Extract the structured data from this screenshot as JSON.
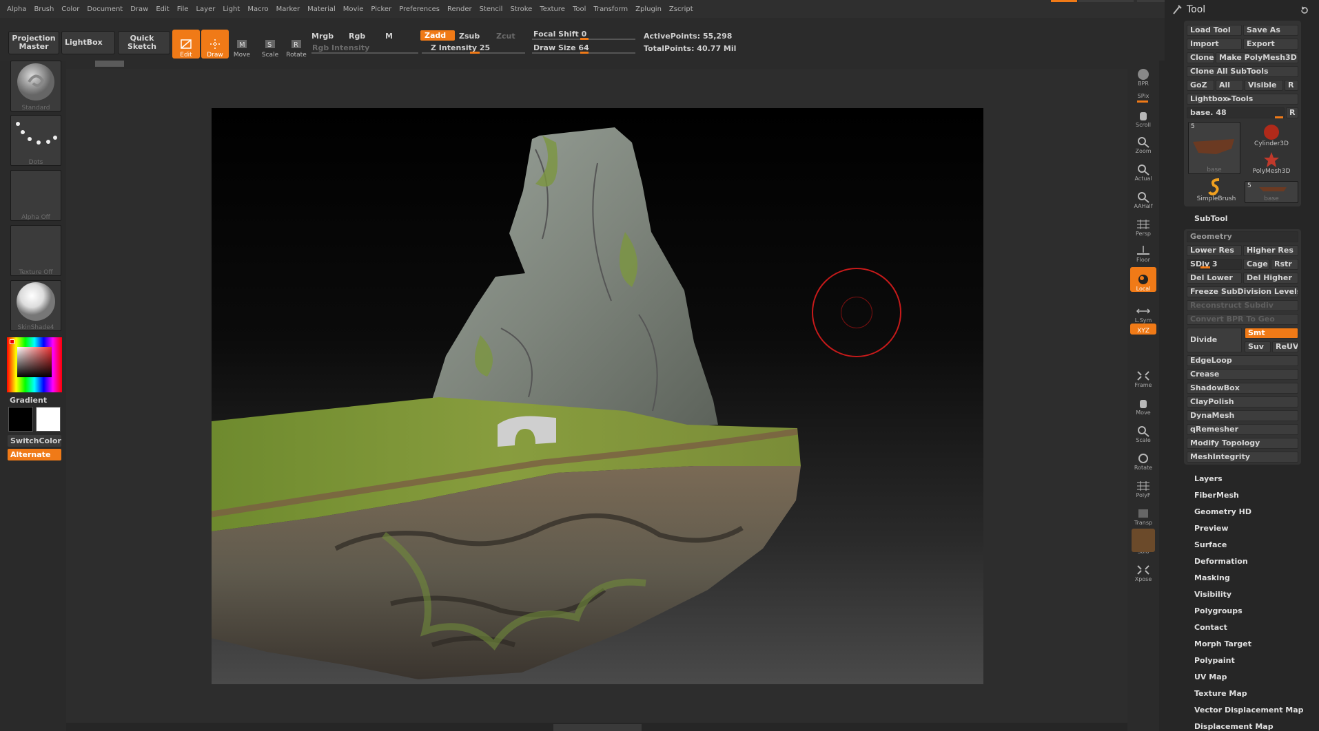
{
  "menu": [
    "Alpha",
    "Brush",
    "Color",
    "Document",
    "Draw",
    "Edit",
    "File",
    "Layer",
    "Light",
    "Macro",
    "Marker",
    "Material",
    "Movie",
    "Picker",
    "Preferences",
    "Render",
    "Stencil",
    "Stroke",
    "Texture",
    "Tool",
    "Transform",
    "Zplugin",
    "Zscript"
  ],
  "toolbar": {
    "projection_master": "Projection Master",
    "lightbox": "LightBox",
    "quick_sketch": "Quick Sketch",
    "edit": "Edit",
    "draw": "Draw",
    "move": "Move",
    "scale": "Scale",
    "rotate": "Rotate",
    "mrgb": "Mrgb",
    "rgb": "Rgb",
    "m": "M",
    "rgb_intensity": "Rgb Intensity",
    "zadd": "Zadd",
    "zsub": "Zsub",
    "zcut": "Zcut",
    "z_intensity": "Z Intensity 25",
    "focal_shift": "Focal Shift 0",
    "draw_size": "Draw Size 64",
    "active_points": "ActivePoints: 55,298",
    "total_points": "TotalPoints: 40.77 Mil"
  },
  "left_tray": {
    "brush": "Standard",
    "stroke": "Dots",
    "alpha": "Alpha Off",
    "texture": "Texture Off",
    "material": "SkinShade4",
    "gradient": "Gradient",
    "switch_color": "SwitchColor",
    "alternate": "Alternate"
  },
  "right_shelf": [
    "BPR",
    "SPix",
    "Scroll",
    "Zoom",
    "Actual",
    "AAHalf",
    "Persp",
    "Floor",
    "Local",
    "L.Sym",
    "Frame",
    "Move",
    "Scale",
    "Rotate",
    "PolyF",
    "Transp",
    "Solo",
    "Xpose"
  ],
  "right_shelf_xyz": "XYZ",
  "tool_palette": {
    "title": "Tool",
    "load_tool": "Load Tool",
    "save_as": "Save As",
    "import": "Import",
    "export": "Export",
    "clone": "Clone",
    "make_polymesh": "Make PolyMesh3D",
    "clone_all": "Clone All SubTools",
    "goz": "GoZ",
    "all": "All",
    "visible": "Visible",
    "r": "R",
    "lightbox_tools": "Lightbox▸Tools",
    "base_slider": "base. 48",
    "thumbs": [
      {
        "label": "base",
        "count": "5"
      },
      {
        "label": "Cylinder3D"
      },
      {
        "label": "PolyMesh3D"
      },
      {
        "label": "SimpleBrush"
      },
      {
        "label": "base",
        "count": "5"
      }
    ],
    "subtool": "SubTool",
    "geometry": "Geometry",
    "lower_res": "Lower Res",
    "higher_res": "Higher Res",
    "sdiv": "SDiv 3",
    "cage": "Cage",
    "rstr": "Rstr",
    "del_lower": "Del Lower",
    "del_higher": "Del Higher",
    "freeze": "Freeze SubDivision Levels",
    "reconstruct": "Reconstruct Subdiv",
    "convert_bpr": "Convert BPR To Geo",
    "divide": "Divide",
    "smt": "Smt",
    "suv": "Suv",
    "reuv": "ReUV",
    "geom_items": [
      "EdgeLoop",
      "Crease",
      "ShadowBox",
      "ClayPolish",
      "DynaMesh",
      "qRemesher",
      "Modify Topology",
      "MeshIntegrity"
    ],
    "sections": [
      "Layers",
      "FiberMesh",
      "Geometry HD",
      "Preview",
      "Surface",
      "Deformation",
      "Masking",
      "Visibility",
      "Polygroups",
      "Contact",
      "Morph Target",
      "Polypaint",
      "UV Map",
      "Texture Map",
      "Vector Displacement Map",
      "Displacement Map"
    ]
  },
  "colors": {
    "accent": "#f07a17",
    "panel": "#262626",
    "button": "#3d3d3d"
  }
}
